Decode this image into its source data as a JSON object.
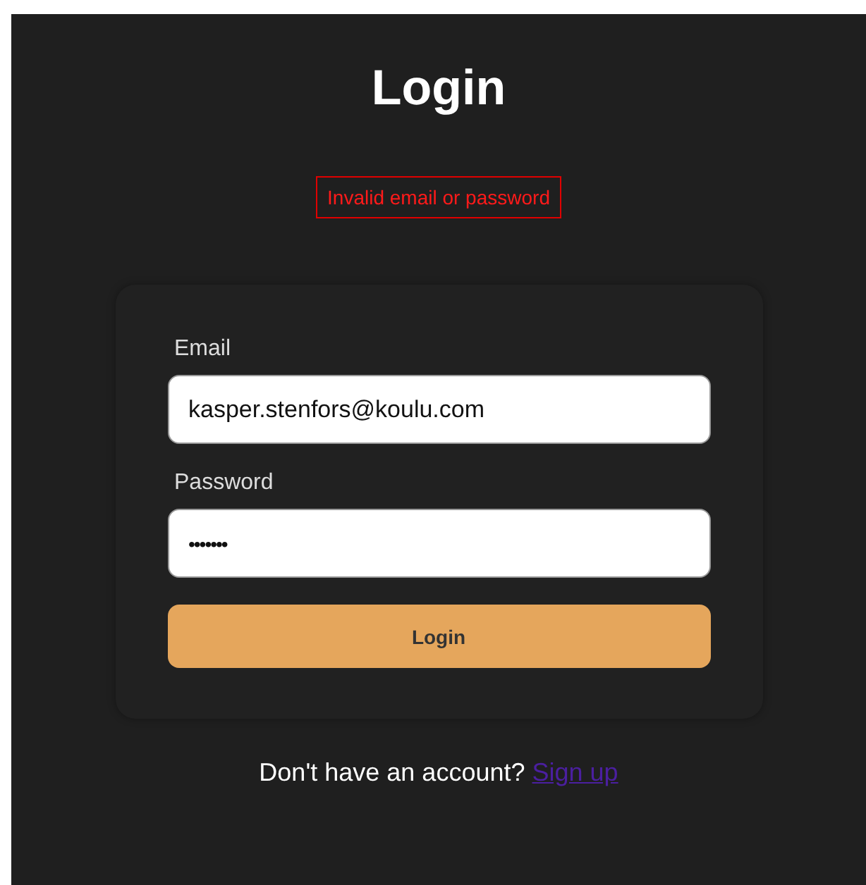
{
  "title": "Login",
  "error": "Invalid email or password",
  "fields": [
    {
      "label": "Email",
      "value": "kasper.stenfors@koulu.com",
      "kind": "text"
    },
    {
      "label": "Password",
      "value": "•••••••",
      "kind": "password"
    }
  ],
  "submit": "Login",
  "footer": {
    "text": "Don't have an account?",
    "link": "Sign up"
  }
}
